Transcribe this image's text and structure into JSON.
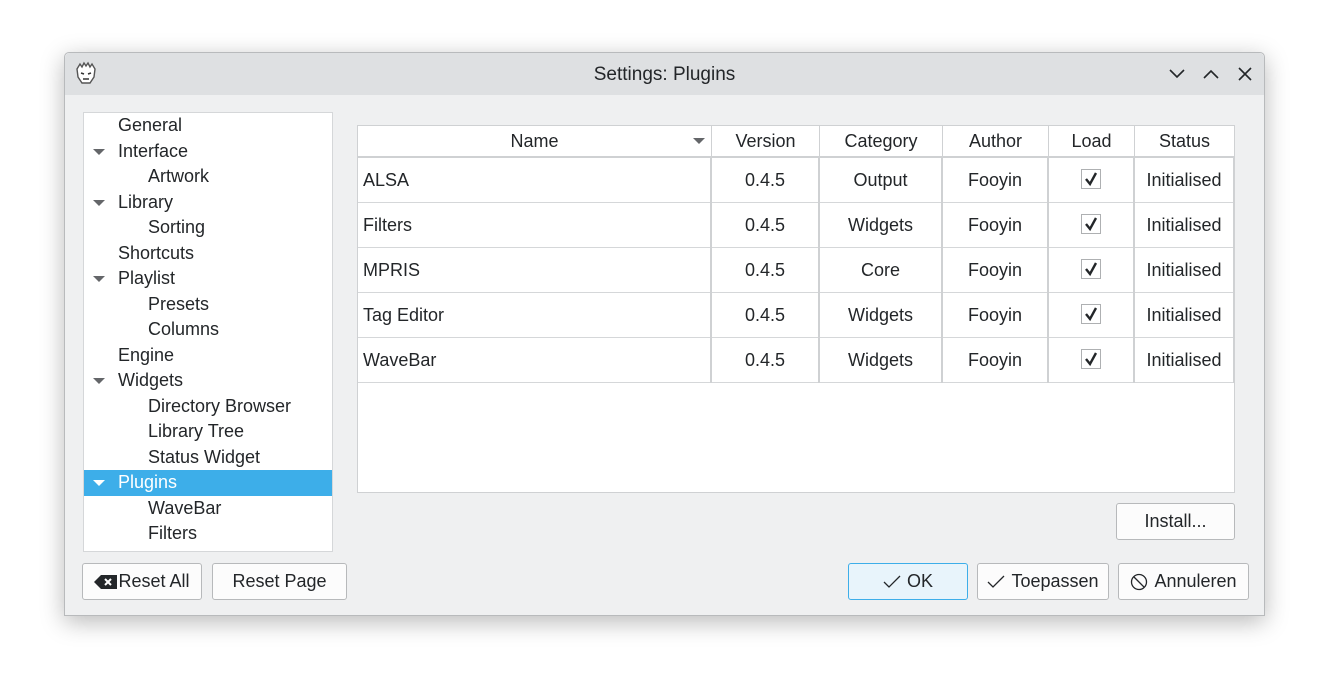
{
  "window": {
    "title": "Settings: Plugins",
    "app_icon": "fooyin-logo-icon"
  },
  "titlebar_buttons": [
    "minimize",
    "maximize",
    "close"
  ],
  "tree": [
    {
      "label": "General",
      "level": 0,
      "expandable": false
    },
    {
      "label": "Interface",
      "level": 0,
      "expandable": true
    },
    {
      "label": "Artwork",
      "level": 1
    },
    {
      "label": "Library",
      "level": 0,
      "expandable": true
    },
    {
      "label": "Sorting",
      "level": 1
    },
    {
      "label": "Shortcuts",
      "level": 0,
      "expandable": false
    },
    {
      "label": "Playlist",
      "level": 0,
      "expandable": true
    },
    {
      "label": "Presets",
      "level": 1
    },
    {
      "label": "Columns",
      "level": 1
    },
    {
      "label": "Engine",
      "level": 0,
      "expandable": false
    },
    {
      "label": "Widgets",
      "level": 0,
      "expandable": true
    },
    {
      "label": "Directory Browser",
      "level": 1
    },
    {
      "label": "Library Tree",
      "level": 1
    },
    {
      "label": "Status Widget",
      "level": 1
    },
    {
      "label": "Plugins",
      "level": 0,
      "expandable": true,
      "selected": true
    },
    {
      "label": "WaveBar",
      "level": 1
    },
    {
      "label": "Filters",
      "level": 1
    }
  ],
  "table": {
    "columns": [
      "Name",
      "Version",
      "Category",
      "Author",
      "Load",
      "Status"
    ],
    "sort_column": "Name",
    "rows": [
      {
        "name": "ALSA",
        "version": "0.4.5",
        "category": "Output",
        "author": "Fooyin",
        "load": true,
        "status": "Initialised"
      },
      {
        "name": "Filters",
        "version": "0.4.5",
        "category": "Widgets",
        "author": "Fooyin",
        "load": true,
        "status": "Initialised"
      },
      {
        "name": "MPRIS",
        "version": "0.4.5",
        "category": "Core",
        "author": "Fooyin",
        "load": true,
        "status": "Initialised"
      },
      {
        "name": "Tag Editor",
        "version": "0.4.5",
        "category": "Widgets",
        "author": "Fooyin",
        "load": true,
        "status": "Initialised"
      },
      {
        "name": "WaveBar",
        "version": "0.4.5",
        "category": "Widgets",
        "author": "Fooyin",
        "load": true,
        "status": "Initialised"
      }
    ]
  },
  "buttons": {
    "install": "Install...",
    "reset_all": "Reset All",
    "reset_page": "Reset Page",
    "ok": "OK",
    "apply": "Toepassen",
    "cancel": "Annuleren"
  },
  "colors": {
    "accent": "#3daee9",
    "background": "#eff0f1"
  }
}
